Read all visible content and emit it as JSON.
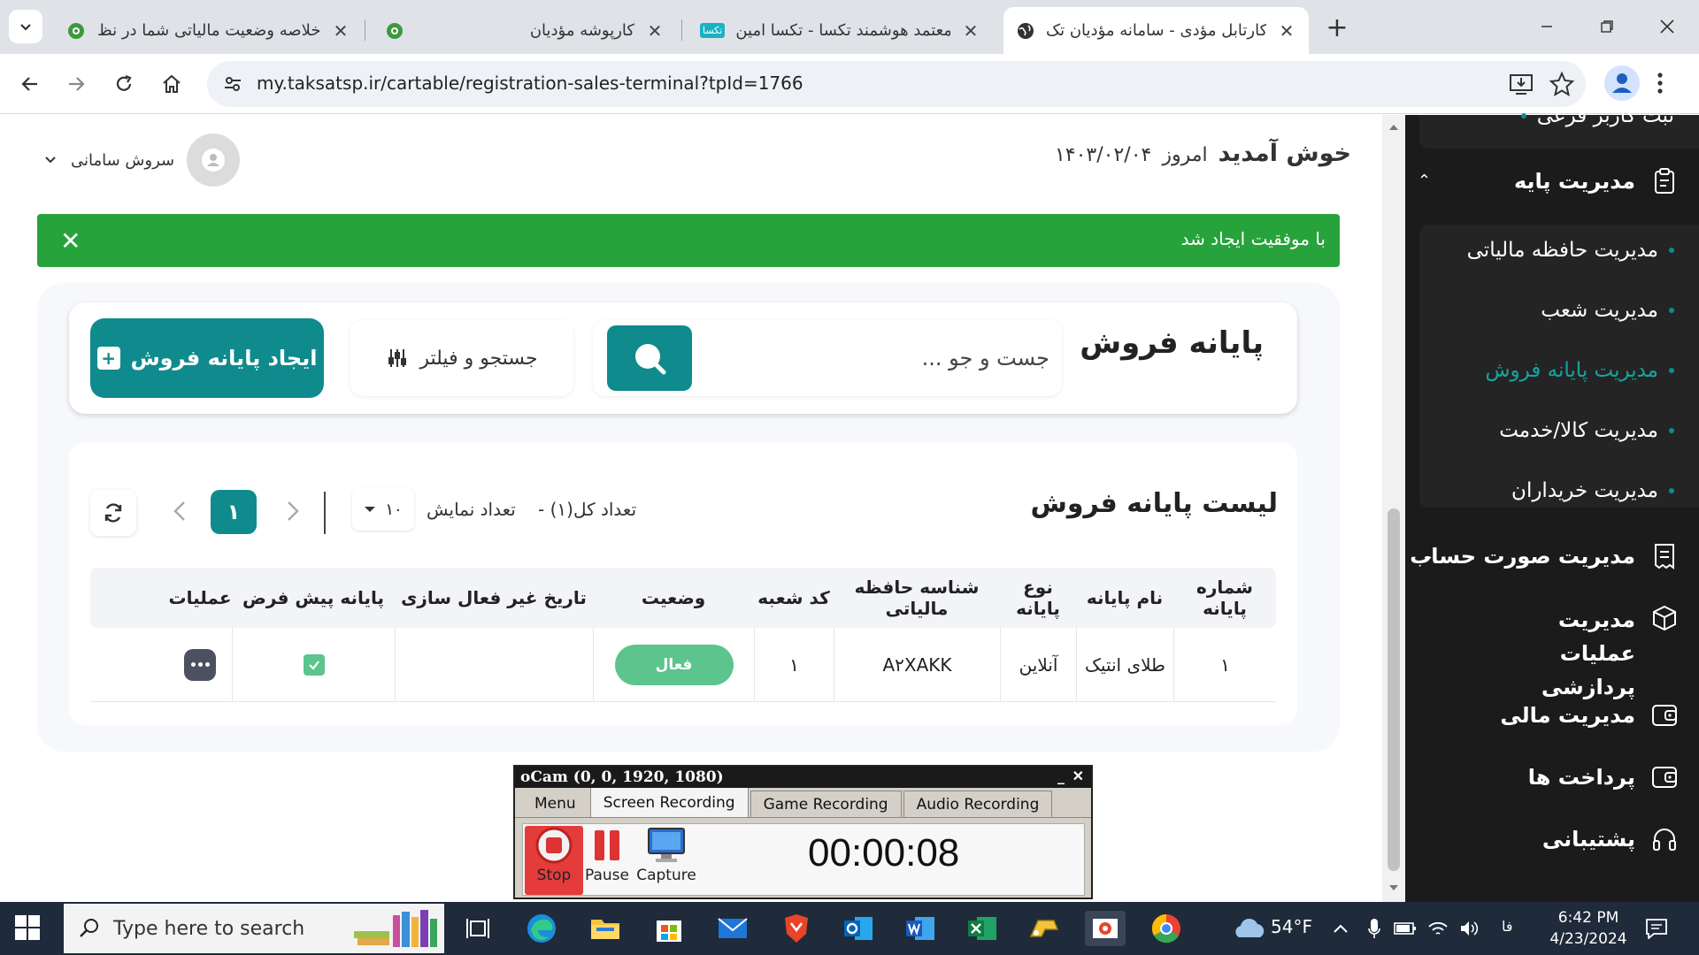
{
  "browser": {
    "tabs": [
      {
        "title": "خلاصه وضعیت مالیاتی شما در نظ",
        "favicon": "gear-icon"
      },
      {
        "title": "کارپوشه مؤدیان",
        "favicon": "gear-icon"
      },
      {
        "title": "معتمد هوشمند تکسا - تکسا امین",
        "favicon": "taksa-logo"
      },
      {
        "title": "کارتابل مؤدی - سامانه مؤدیان تک",
        "favicon": "globe-icon",
        "active": true
      }
    ],
    "url": "my.taksatsp.ir/cartable/registration-sales-terminal?tpId=1766"
  },
  "header": {
    "welcome": "خوش آمدید",
    "today_label": "امروز",
    "today_date": "۱۴۰۳/۰۲/۰۴",
    "user_name": "سروش سامانی"
  },
  "alert": {
    "message": "با موفقیت ایجاد شد",
    "color": "#27a33c"
  },
  "terminal": {
    "title": "پایانه فروش",
    "search_placeholder": "جست و جو ...",
    "filter_label": "جستجو و فیلتر",
    "create_label": "ایجاد پایانه فروش"
  },
  "list": {
    "title": "لیست پایانه فروش",
    "total_count": "تعداد کل(۱) -",
    "show_label": "تعداد نمایش",
    "page_size": "۱۰",
    "current_page": "۱",
    "columns": [
      "شماره پایانه",
      "نام پایانه",
      "نوع پایانه",
      "شناسه حافظه مالیاتی",
      "کد شعبه",
      "وضعیت",
      "تاریخ غیر فعال سازی",
      "پایانه پیش فرض",
      "عملیات"
    ],
    "rows": [
      {
        "number": "۱",
        "name": "طلای انتیک",
        "type": "آنلاین",
        "memory_id": "A۲XAKK",
        "branch": "۱",
        "status": "فعال",
        "deactivation": "",
        "default": true
      }
    ]
  },
  "sidebar": {
    "top_partial": "ثبت کاربر فرعی",
    "base_management": "مدیریت پایه",
    "sub_items": [
      "مدیریت حافظه مالیاتی",
      "مدیریت شعب",
      "مدیریت پایانه فروش",
      "مدیریت کالا/خدمت",
      "مدیریت خریداران"
    ],
    "active_sub": "مدیریت پایانه فروش",
    "main_items": [
      {
        "label": "مدیریت صورت حساب",
        "icon": "receipt-icon"
      },
      {
        "label": "مدیریت عملیات پردازشی",
        "icon": "cube-icon"
      },
      {
        "label": "مدیریت مالی",
        "icon": "wallet-icon"
      },
      {
        "label": "پرداخت ها",
        "icon": "wallet-icon"
      },
      {
        "label": "پشتیبانی",
        "icon": "headset-icon"
      }
    ],
    "accent": "#0f8b8d"
  },
  "bandicam": {
    "title": "oCam (0, 0, 1920, 1080)",
    "tabs": [
      "Menu",
      "Screen Recording",
      "Game Recording",
      "Audio Recording"
    ],
    "active_tab": "Screen Recording",
    "buttons": [
      "Stop",
      "Pause",
      "Capture"
    ],
    "timer": "00:00:08"
  },
  "taskbar": {
    "search_placeholder": "Type here to search",
    "weather": "54°F",
    "lang": "فا",
    "time": "6:42 PM",
    "date": "4/23/2024"
  }
}
